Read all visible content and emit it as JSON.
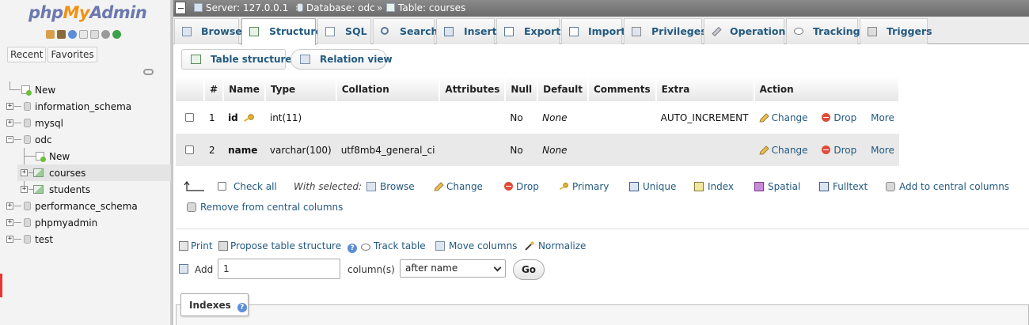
{
  "nav": {
    "logo": {
      "php": "php",
      "my": "My",
      "admin": "Admin"
    },
    "tabs": [
      "Recent",
      "Favorites"
    ],
    "tree": [
      {
        "label": "New"
      },
      {
        "label": "information_schema"
      },
      {
        "label": "mysql"
      },
      {
        "label": "odc"
      },
      {
        "label": "New"
      },
      {
        "label": "courses"
      },
      {
        "label": "students"
      },
      {
        "label": "performance_schema"
      },
      {
        "label": "phpmyadmin"
      },
      {
        "label": "test"
      }
    ]
  },
  "breadcrumb": {
    "server": "Server: 127.0.0.1",
    "database": "Database: odc",
    "table": "Table: courses",
    "separator": "»"
  },
  "tabs": [
    {
      "label": "Browse",
      "icon": "browse-icon"
    },
    {
      "label": "Structure",
      "icon": "structure-icon",
      "active": true
    },
    {
      "label": "SQL",
      "icon": "sql-icon"
    },
    {
      "label": "Search",
      "icon": "search-icon"
    },
    {
      "label": "Insert",
      "icon": "insert-icon"
    },
    {
      "label": "Export",
      "icon": "export-icon"
    },
    {
      "label": "Import",
      "icon": "import-icon"
    },
    {
      "label": "Privileges",
      "icon": "privileges-icon"
    },
    {
      "label": "Operations",
      "icon": "operations-icon"
    },
    {
      "label": "Tracking",
      "icon": "tracking-icon"
    },
    {
      "label": "Triggers",
      "icon": "triggers-icon"
    }
  ],
  "subtabs": {
    "table_structure": "Table structure",
    "relation_view": "Relation view"
  },
  "structure": {
    "headers": [
      "#",
      "Name",
      "Type",
      "Collation",
      "Attributes",
      "Null",
      "Default",
      "Comments",
      "Extra",
      "Action"
    ],
    "rows": [
      {
        "num": "1",
        "name": "id",
        "type": "int(11)",
        "collation": "",
        "attributes": "",
        "null": "No",
        "default": "None",
        "comments": "",
        "extra": "AUTO_INCREMENT"
      },
      {
        "num": "2",
        "name": "name",
        "type": "varchar(100)",
        "collation": "utf8mb4_general_ci",
        "attributes": "",
        "null": "No",
        "default": "None",
        "comments": "",
        "extra": ""
      }
    ],
    "actions": {
      "change": "Change",
      "drop": "Drop",
      "more": "More"
    }
  },
  "with_selected": {
    "check_all": "Check all",
    "label": "With selected:",
    "items": [
      "Browse",
      "Change",
      "Drop",
      "Primary",
      "Unique",
      "Index",
      "Spatial",
      "Fulltext",
      "Add to central columns"
    ],
    "remove_central": "Remove from central columns"
  },
  "tools": {
    "print": "Print",
    "propose": "Propose table structure",
    "track": "Track table",
    "move": "Move columns",
    "normalize": "Normalize"
  },
  "add_columns": {
    "add_label": "Add",
    "count_value": "1",
    "columns_label": "column(s)",
    "position_selected": "after name",
    "go_label": "Go"
  },
  "indexes": {
    "legend": "Indexes"
  },
  "colors": {
    "link": "#235a81",
    "topbar": "#777777",
    "logo_blue": "#6c78af",
    "logo_orange": "#f29111"
  }
}
